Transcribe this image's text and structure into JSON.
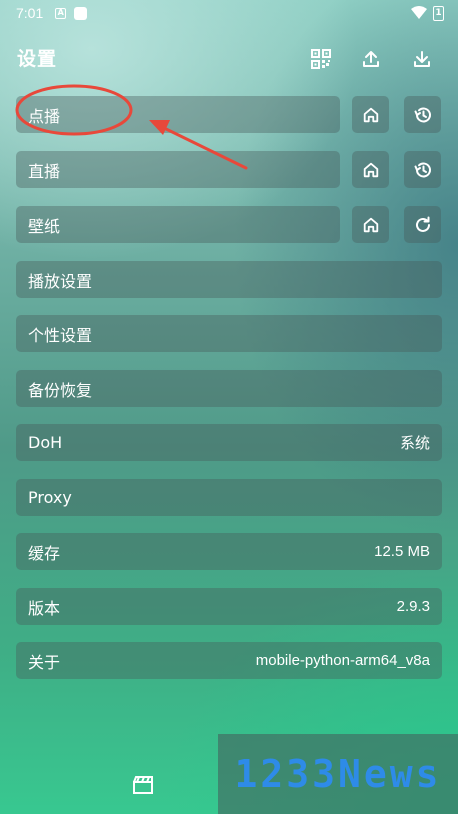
{
  "status_bar": {
    "time": "7:01",
    "notification_icon": "A",
    "battery_label": "1"
  },
  "header": {
    "title": "设置",
    "buttons": [
      "qr-code-icon",
      "upload-icon",
      "download-icon"
    ]
  },
  "rows": {
    "vod": {
      "label": "点播",
      "buttons": [
        "home-icon",
        "history-icon"
      ]
    },
    "live": {
      "label": "直播",
      "buttons": [
        "home-icon",
        "history-icon"
      ]
    },
    "wallpaper": {
      "label": "壁纸",
      "buttons": [
        "home-icon",
        "refresh-icon"
      ]
    },
    "playback": {
      "label": "播放设置"
    },
    "personalization": {
      "label": "个性设置"
    },
    "backup": {
      "label": "备份恢复"
    },
    "doh": {
      "label": "DoH",
      "value": "系统"
    },
    "proxy": {
      "label": "Proxy"
    },
    "cache": {
      "label": "缓存",
      "value": "12.5 MB"
    },
    "version": {
      "label": "版本",
      "value": "2.9.3"
    },
    "about": {
      "label": "关于",
      "value": "mobile-python-arm64_v8a"
    }
  },
  "annotation": {
    "color": "#e8483a",
    "shapes": [
      "circle",
      "arrow"
    ]
  },
  "bottom_nav": {
    "icon": "clapperboard-icon"
  },
  "watermark": {
    "text": "1233News",
    "color": "#2e8be8"
  }
}
